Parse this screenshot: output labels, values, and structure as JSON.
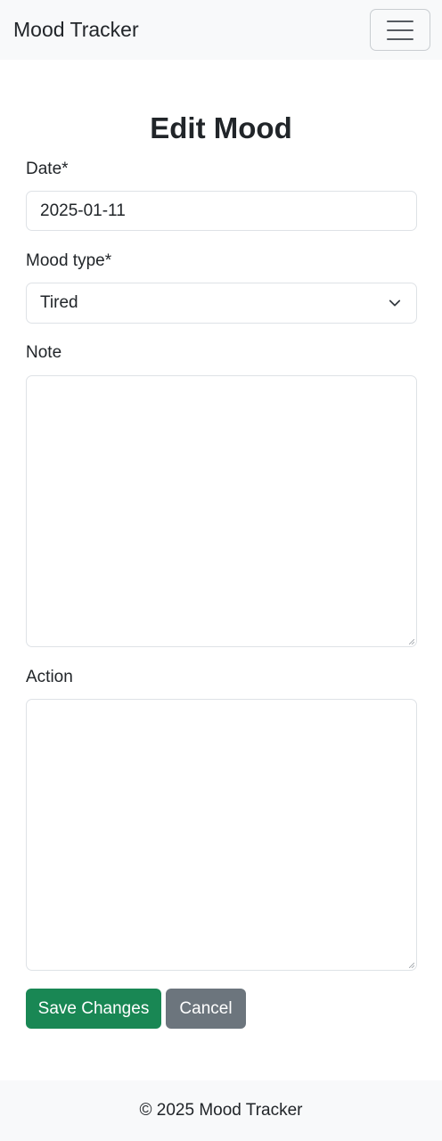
{
  "navbar": {
    "brand": "Mood Tracker"
  },
  "form": {
    "title": "Edit Mood",
    "date_label": "Date*",
    "date_value": "2025-01-11",
    "mood_type_label": "Mood type*",
    "mood_type_value": "Tired",
    "note_label": "Note",
    "note_value": "",
    "action_label": "Action",
    "action_value": "",
    "save_label": "Save Changes",
    "cancel_label": "Cancel"
  },
  "footer": {
    "text": "© 2025 Mood Tracker"
  },
  "colors": {
    "primary_success": "#198754",
    "secondary": "#6c757d",
    "navbar_bg": "#f8f9fa"
  }
}
